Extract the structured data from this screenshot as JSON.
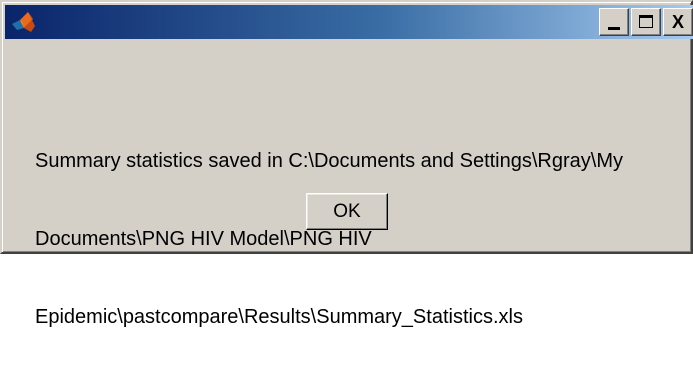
{
  "window": {
    "title": "",
    "icon": "matlab-icon",
    "controls": {
      "minimize_icon": "minimize-icon",
      "maximize_icon": "maximize-icon",
      "close_label": "X"
    }
  },
  "dialog": {
    "message_lines": [
      "Summary statistics saved in C:\\Documents and Settings\\Rgray\\My",
      "Documents\\PNG HIV Model\\PNG HIV",
      "Epidemic\\pastcompare\\Results\\Summary_Statistics.xls"
    ],
    "ok_label": "OK"
  },
  "colors": {
    "titlebar_start": "#0a246a",
    "titlebar_end": "#a6caf0",
    "face": "#d4d0c8"
  }
}
